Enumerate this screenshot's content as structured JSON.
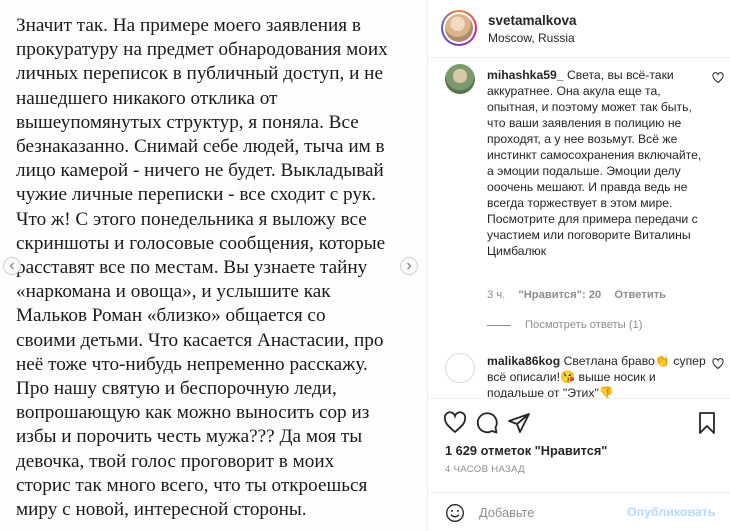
{
  "post_image": {
    "lines": [
      "Значит так. На примере моего заявления в",
      "прокуратуру на предмет обнародования моих",
      "личных переписок в публичный доступ, и не",
      "нашедшего никакого отклика от",
      "вышеупомянутых структур, я поняла. Все",
      "безнаказанно. Снимай себе людей, тыча им в",
      "лицо камерой - ничего не будет. Выкладывай",
      "чужие личные переписки - все сходит с рук.",
      "Что ж! С этого понедельника я выложу все",
      "скриншоты и голосовые сообщения, которые",
      "расставят все по местам. Вы узнаете тайну",
      "«наркомана и овоща», и услышите как",
      "Мальков Роман «близко» общается со",
      "своими детьми. Что касается Анастасии, про",
      "неё тоже что-нибудь непременно расскажу.",
      "Про нашу святую и беспорочную леди,",
      "вопрошающую как можно выносить сор из",
      "избы и порочить честь мужа??? Да моя ты",
      "девочка, твой голос проговорит в моих",
      "сторис так много всего, что ты откроешься",
      "миру с новой, интересной стороны."
    ]
  },
  "header": {
    "username": "svetamalkova",
    "location": "Moscow, Russia"
  },
  "comments": [
    {
      "user": "mihashka59_",
      "text": "Света, вы всё-таки аккуратнее. Она акула еще та, опытная, и поэтому может так быть, что ваши заявления в полицию не проходят, а у нее возьмут. Всё же инстинкт самосохранения включайте, а эмоции подальше. Эмоции делу ооочень мешают. И правда ведь не всегда торжествует в этом мире. Посмотрите для примера передачи с участием или поговорите Виталины Цимбалюк",
      "time": "3 ч.",
      "likes_label": "\"Нравится\": 20",
      "reply_label": "Ответить",
      "view_replies": "Посмотреть ответы (1)"
    },
    {
      "user": "malika86kog",
      "text": "Светлана браво👏 супер всё описали!😘 выше носик и подальше от \"Этих\"👎"
    }
  ],
  "likes": {
    "count": "1 629",
    "suffix": "отметок \"Нравится\""
  },
  "timestamp": "4 ЧАСОВ НАЗАД",
  "add_comment": {
    "placeholder": "Добавьте",
    "publish_label": "Опубликовать"
  },
  "colors": {
    "accent_disabled": "#b3dbff",
    "muted": "#8e8e8e",
    "border": "#efefef"
  }
}
